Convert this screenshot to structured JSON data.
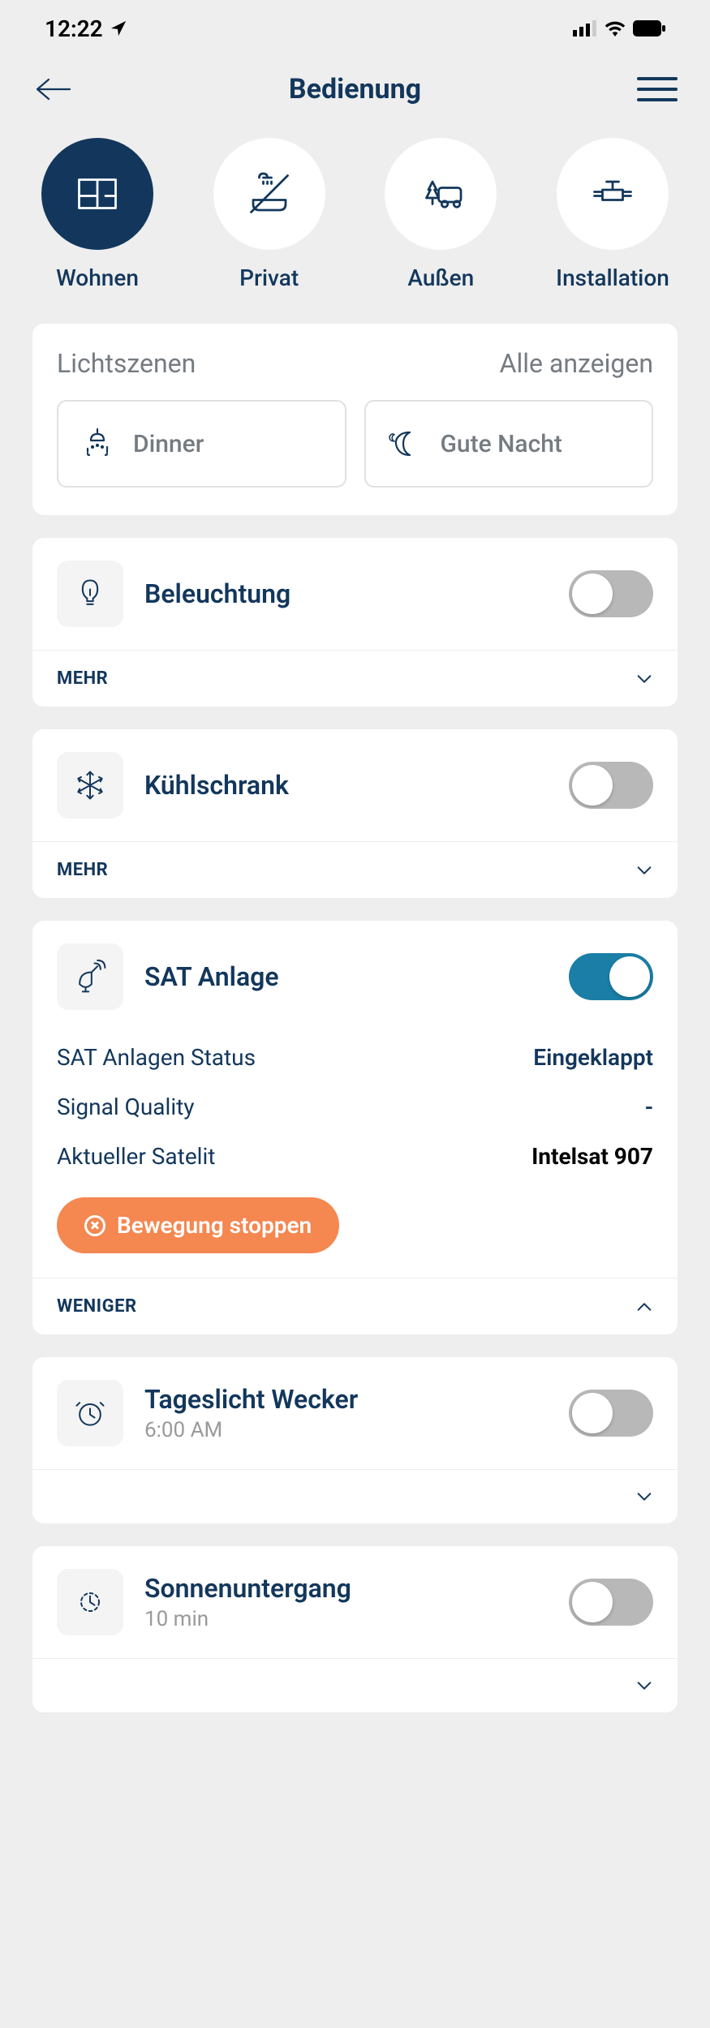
{
  "status": {
    "time": "12:22"
  },
  "nav": {
    "title": "Bedienung"
  },
  "categories": [
    {
      "label": "Wohnen",
      "active": true
    },
    {
      "label": "Privat",
      "active": false
    },
    {
      "label": "Außen",
      "active": false
    },
    {
      "label": "Installation",
      "active": false
    }
  ],
  "scenes": {
    "title": "Lichtszenen",
    "all_link": "Alle anzeigen",
    "items": [
      "Dinner",
      "Gute Nacht"
    ]
  },
  "expand_more": "MEHR",
  "expand_less": "WENIGER",
  "devices": {
    "lighting": {
      "title": "Beleuchtung",
      "on": false
    },
    "fridge": {
      "title": "Kühlschrank",
      "on": false
    },
    "sat": {
      "title": "SAT Anlage",
      "on": true,
      "rows": [
        {
          "label": "SAT Anlagen Status",
          "value": "Eingeklappt",
          "style": "blue"
        },
        {
          "label": "Signal Quality",
          "value": "-",
          "style": "blue"
        },
        {
          "label": "Aktueller Satelit",
          "value": "Intelsat 907",
          "style": "black"
        }
      ],
      "stop_label": "Bewegung stoppen"
    },
    "alarm": {
      "title": "Tageslicht Wecker",
      "subtitle": "6:00 AM",
      "on": false
    },
    "sunset": {
      "title": "Sonnenuntergang",
      "subtitle": "10 min",
      "on": false
    }
  }
}
